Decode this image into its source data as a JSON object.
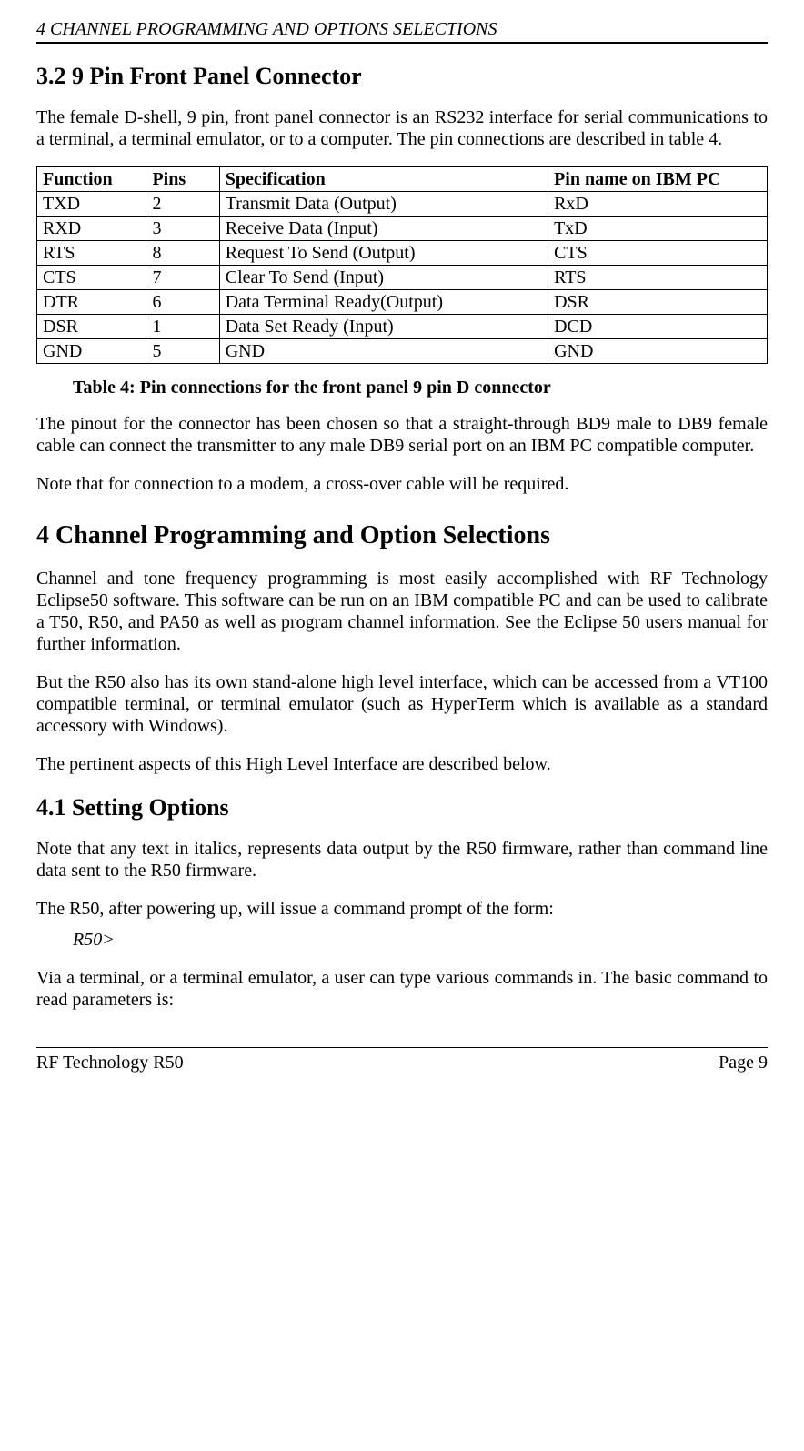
{
  "header": {
    "running": "4  CHANNEL PROGRAMMING AND OPTIONS SELECTIONS"
  },
  "s32": {
    "heading": "3.2  9 Pin Front Panel Connector",
    "p1": "The female D-shell, 9 pin, front panel connector is an RS232 interface for serial communications to a terminal, a terminal emulator, or to a computer. The pin connections are described in table 4."
  },
  "table4": {
    "headers": {
      "func": "Function",
      "pins": "Pins",
      "spec": "Specification",
      "pc": "Pin name on IBM PC"
    },
    "rows": [
      {
        "func": "TXD",
        "pins": "2",
        "spec": "Transmit Data (Output)",
        "pc": "RxD"
      },
      {
        "func": "RXD",
        "pins": "3",
        "spec": "Receive Data (Input)",
        "pc": "TxD"
      },
      {
        "func": "RTS",
        "pins": "8",
        "spec": "Request To Send (Output)",
        "pc": "CTS"
      },
      {
        "func": "CTS",
        "pins": "7",
        "spec": "Clear To Send (Input)",
        "pc": "RTS"
      },
      {
        "func": "DTR",
        "pins": "6",
        "spec": "Data Terminal Ready(Output)",
        "pc": "DSR"
      },
      {
        "func": "DSR",
        "pins": "1",
        "spec": "Data Set Ready (Input)",
        "pc": "DCD"
      },
      {
        "func": "GND",
        "pins": "5",
        "spec": "GND",
        "pc": "GND"
      }
    ],
    "caption": "Table 4:  Pin connections for the front panel 9 pin D connector"
  },
  "post_table": {
    "p1": "The pinout for the connector has been chosen so that a straight-through BD9 male to DB9 female cable can connect the transmitter to any male DB9 serial port on an IBM PC compatible computer.",
    "p2": "Note that for connection to a modem, a cross-over cable will be required."
  },
  "s4": {
    "heading": "4     Channel Programming and Option Selections",
    "p1": "Channel and tone frequency programming is most easily accomplished with RF Technology Eclipse50 software.  This software can be run on an IBM compatible PC and can be used to calibrate a T50, R50, and PA50 as well as program channel information.  See the Eclipse 50 users manual for further information.",
    "p2": "But the R50 also has its own stand-alone high level interface, which can be accessed from a VT100 compatible terminal, or terminal emulator (such as HyperTerm which is available as a standard accessory with Windows).",
    "p3": "The pertinent aspects of this High Level Interface are described below."
  },
  "s41": {
    "heading": "4.1  Setting Options",
    "p1": "Note that any text in italics, represents data output by the R50 firmware, rather than command line data sent to the R50 firmware.",
    "p2": "The R50, after powering up, will issue a command prompt of the form:",
    "prompt": "R50>",
    "p3": "Via a terminal, or a terminal emulator, a user can type various commands in. The basic command to read parameters is:"
  },
  "footer": {
    "left": "RF Technology   R50",
    "right": "Page 9"
  }
}
